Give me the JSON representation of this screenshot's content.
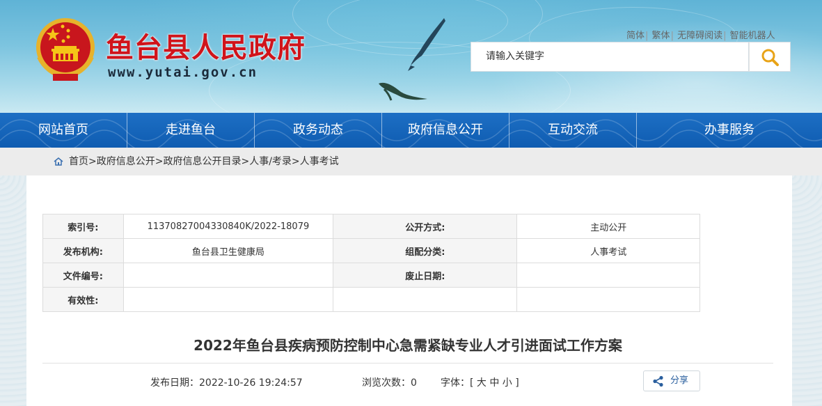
{
  "header": {
    "site_title": "鱼台县人民政府",
    "site_url": "www.yutai.gov.cn",
    "top_links": [
      "简体",
      "繁体",
      "无障碍阅读",
      "智能机器人"
    ],
    "search_placeholder": "请输入关键字"
  },
  "nav": {
    "items": [
      "网站首页",
      "走进鱼台",
      "政务动态",
      "政府信息公开",
      "互动交流",
      "办事服务"
    ]
  },
  "breadcrumb": "首页>政府信息公开>政府信息公开目录>人事/考录>人事考试",
  "meta_table": {
    "index_label": "索引号:",
    "index_value": "11370827004330840K/2022-18079",
    "open_label": "公开方式:",
    "open_value": "主动公开",
    "publisher_label": "发布机构:",
    "publisher_value": "鱼台县卫生健康局",
    "category_label": "组配分类:",
    "category_value": "人事考试",
    "docno_label": "文件编号:",
    "docno_value": "",
    "abolish_label": "废止日期:",
    "abolish_value": "",
    "validity_label": "有效性:",
    "validity_value": ""
  },
  "article": {
    "title": "2022年鱼台县疾病预防控制中心急需紧缺专业人才引进面试工作方案",
    "publish_date": "发布日期：2022-10-26 19:24:57",
    "views": "浏览次数：0",
    "font_size": "字体：[ 大 中 小 ]",
    "share_label": "分享"
  },
  "colors": {
    "title_red": "#d0141b",
    "nav_blue": "#1566bb",
    "breadcrumb_bg": "#ececec"
  },
  "icons": [
    "national-emblem-icon",
    "search-icon",
    "home-icon",
    "share-icon"
  ]
}
